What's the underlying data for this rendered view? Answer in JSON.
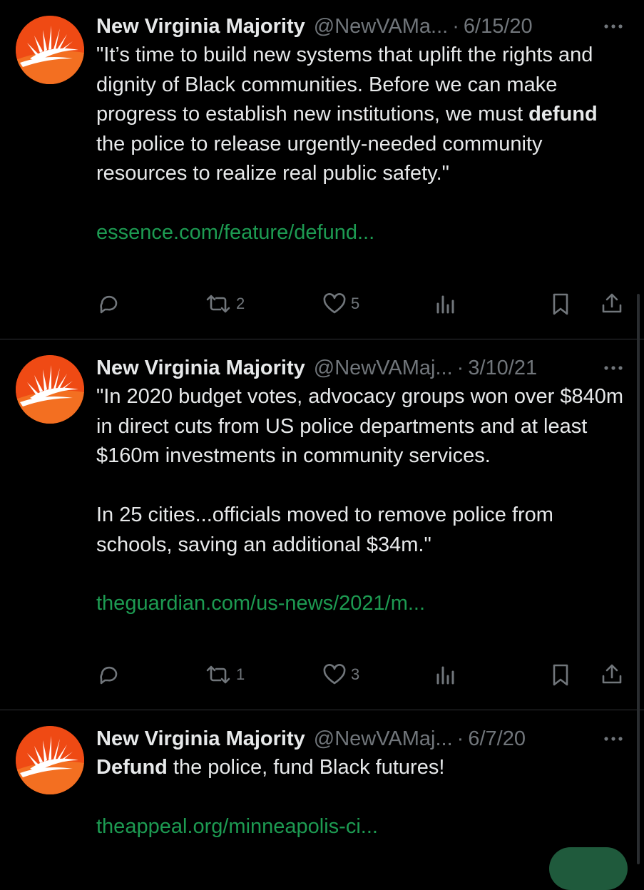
{
  "tweets": [
    {
      "name": "New Virginia Majority",
      "handle": "@NewVAMa...",
      "separator": "·",
      "date": "6/15/20",
      "text_parts": {
        "a": "\"It’s time to build new systems that uplift the rights and dignity of Black communities. Before we can make progress to establish new institutions, we must ",
        "b": "defund",
        "c": " the police to release urgently-needed community resources to realize real public safety.\""
      },
      "link": "essence.com/feature/defund...",
      "retweets": "2",
      "likes": "5"
    },
    {
      "name": "New Virginia Majority",
      "handle": "@NewVAMaj...",
      "separator": "·",
      "date": "3/10/21",
      "text_parts": {
        "a": "\"In 2020 budget votes, advocacy groups won over $840m in direct cuts from US police departments and at least $160m investments in community services.\n\nIn 25 cities...officials moved to remove police from schools, saving an additional $34m.\""
      },
      "link": "theguardian.com/us-news/2021/m...",
      "retweets": "1",
      "likes": "3"
    },
    {
      "name": "New Virginia Majority",
      "handle": "@NewVAMaj...",
      "separator": "·",
      "date": "6/7/20",
      "text_parts": {
        "b": "Defund",
        "c": " the police, fund Black futures!"
      },
      "link": "theappeal.org/minneapolis-ci..."
    }
  ],
  "icons": {
    "avatar": "sunrise-logo",
    "more": "more-horizontal-icon",
    "reply": "reply-icon",
    "retweet": "retweet-icon",
    "like": "heart-icon",
    "views": "analytics-icon",
    "bookmark": "bookmark-icon",
    "share": "share-icon"
  },
  "colors": {
    "background": "#000000",
    "text": "#e7e9ea",
    "muted": "#71767b",
    "link": "#1d9b52",
    "avatar": "#ef4a14"
  }
}
